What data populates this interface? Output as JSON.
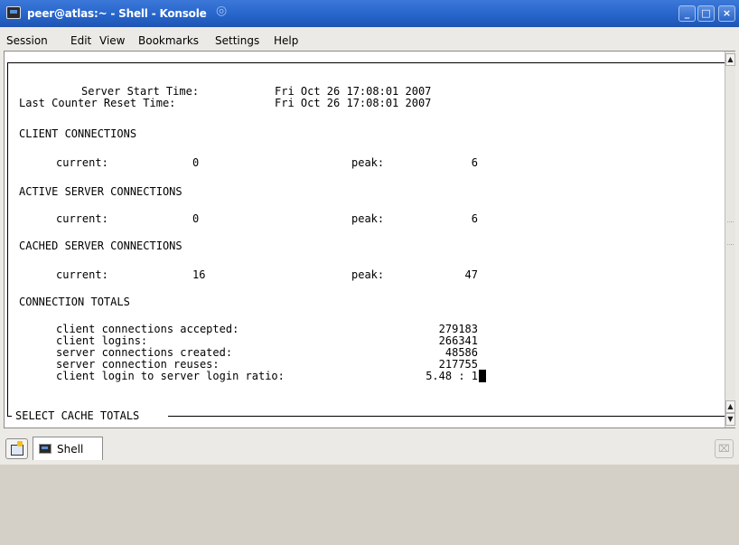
{
  "window": {
    "title": "peer@atlas:~ - Shell - Konsole",
    "buttons": {
      "minimize": "_",
      "maximize": "□",
      "close": "×"
    }
  },
  "menu": [
    "Session",
    "Edit",
    "View",
    "Bookmarks",
    "Settings",
    "Help"
  ],
  "terminal": {
    "server_start_label": "Server Start Time:",
    "server_start_value": "Fri Oct 26 17:08:01 2007",
    "counter_reset_label": "Last Counter Reset Time:",
    "counter_reset_value": "Fri Oct 26 17:08:01 2007",
    "sections": [
      {
        "heading": "CLIENT CONNECTIONS",
        "current_label": "current:",
        "current": "0",
        "peak_label": "peak:",
        "peak": "6"
      },
      {
        "heading": "ACTIVE SERVER CONNECTIONS",
        "current_label": "current:",
        "current": "0",
        "peak_label": "peak:",
        "peak": "6"
      },
      {
        "heading": "CACHED SERVER CONNECTIONS",
        "current_label": "current:",
        "current": "16",
        "peak_label": "peak:",
        "peak": "47"
      }
    ],
    "totals_heading": "CONNECTION TOTALS",
    "totals": [
      {
        "label": "client connections accepted:",
        "value": "279183"
      },
      {
        "label": "client logins:",
        "value": "266341"
      },
      {
        "label": "server connections created:",
        "value": "48586"
      },
      {
        "label": "server connection reuses:",
        "value": "217755"
      },
      {
        "label": "client login to server login ratio:",
        "value": "5.48 : 1"
      }
    ],
    "box_title": "SELECT CACHE TOTALS"
  },
  "tabs": [
    {
      "label": "Shell"
    }
  ]
}
